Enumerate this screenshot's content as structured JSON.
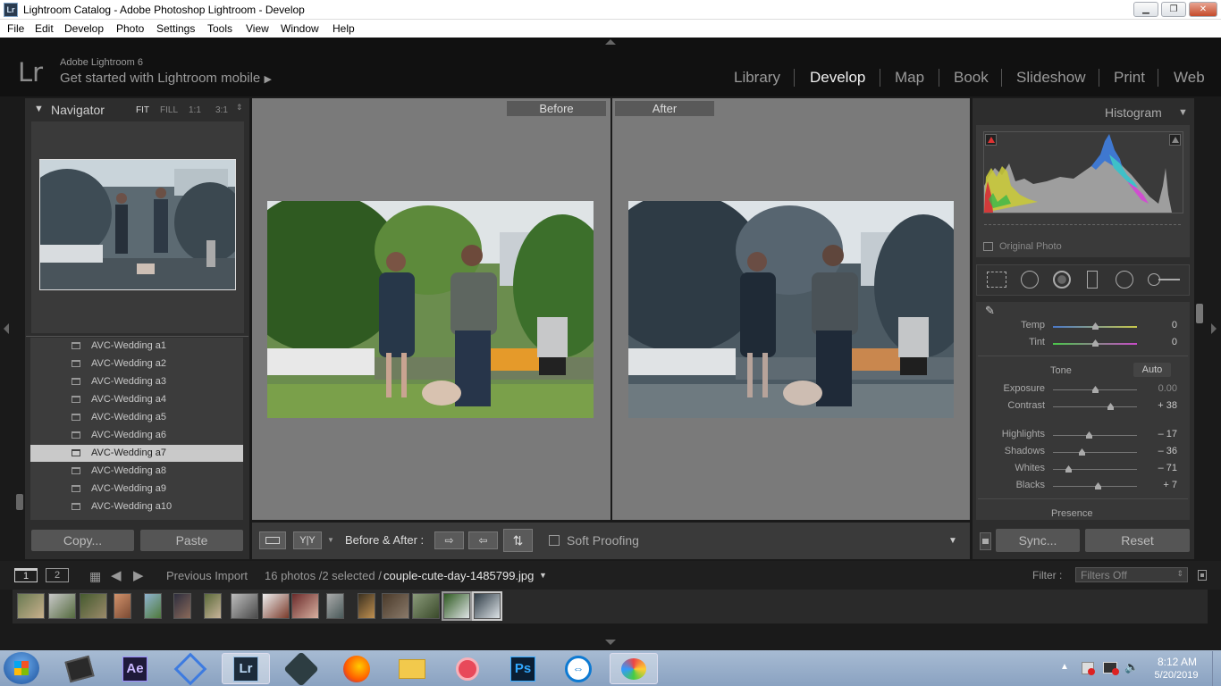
{
  "window": {
    "title": "Lightroom Catalog - Adobe Photoshop Lightroom - Develop",
    "app_icon": "Lr"
  },
  "menu": [
    "File",
    "Edit",
    "Develop",
    "Photo",
    "Settings",
    "Tools",
    "View",
    "Window",
    "Help"
  ],
  "header": {
    "logo": "Lr",
    "version": "Adobe Lightroom 6",
    "mobile_prompt": "Get started with Lightroom mobile",
    "modules": [
      "Library",
      "Develop",
      "Map",
      "Book",
      "Slideshow",
      "Print",
      "Web"
    ],
    "active_module": "Develop"
  },
  "navigator": {
    "title": "Navigator",
    "zoom": [
      "FIT",
      "FILL",
      "1:1",
      "3:1"
    ]
  },
  "collections": [
    "AVC-Wedding a1",
    "AVC-Wedding a2",
    "AVC-Wedding a3",
    "AVC-Wedding a4",
    "AVC-Wedding a5",
    "AVC-Wedding a6",
    "AVC-Wedding a7",
    "AVC-Wedding a8",
    "AVC-Wedding a9",
    "AVC-Wedding a10"
  ],
  "selected_collection": "AVC-Wedding a7",
  "left_buttons": {
    "copy": "Copy...",
    "paste": "Paste"
  },
  "view": {
    "before_label": "Before",
    "after_label": "After"
  },
  "toolbar": {
    "before_after": "Before & After :",
    "soft_proofing": "Soft Proofing",
    "yy": "Y|Y"
  },
  "histogram": {
    "title": "Histogram",
    "original_photo": "Original Photo"
  },
  "basic": {
    "temp": {
      "label": "Temp",
      "value": "0"
    },
    "tint": {
      "label": "Tint",
      "value": "0"
    },
    "tone_label": "Tone",
    "auto_label": "Auto",
    "exposure": {
      "label": "Exposure",
      "value": "0.00"
    },
    "contrast": {
      "label": "Contrast",
      "value": "+ 38"
    },
    "highlights": {
      "label": "Highlights",
      "value": "– 17"
    },
    "shadows": {
      "label": "Shadows",
      "value": "– 36"
    },
    "whites": {
      "label": "Whites",
      "value": "– 71"
    },
    "blacks": {
      "label": "Blacks",
      "value": "+ 7"
    },
    "presence_label": "Presence"
  },
  "right_buttons": {
    "sync": "Sync...",
    "reset": "Reset"
  },
  "filmstrip": {
    "screen1": "1",
    "screen2": "2",
    "source": "Previous Import",
    "count": "16 photos /2 selected /",
    "filename": "couple-cute-day-1485799.jpg",
    "filter_label": "Filter :",
    "filter_value": "Filters Off"
  },
  "taskbar": {
    "time": "8:12 AM",
    "date": "5/20/2019",
    "ae_label": "Ae",
    "lr_label": "Lr",
    "ps_label": "Ps"
  },
  "colors": {
    "accent": "#f0f0f0",
    "panel": "#383838",
    "background": "#1a1a1a"
  }
}
